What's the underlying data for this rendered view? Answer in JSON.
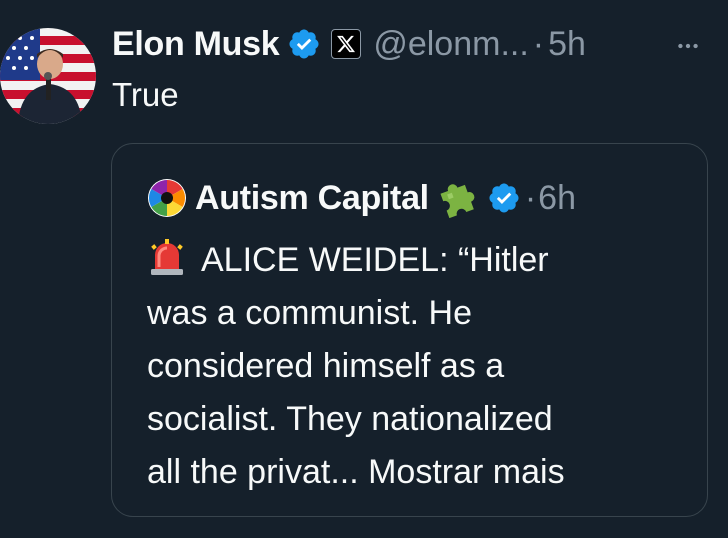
{
  "tweet": {
    "author_name": "Elon Musk",
    "handle": "@elonm...",
    "separator": "·",
    "time": "5h",
    "text": "True"
  },
  "quote": {
    "author_name": "Autism Capital",
    "separator": "·",
    "time": "6h",
    "lines": [
      "ALICE WEIDEL: “Hitler",
      "was a communist. He",
      "considered himself as a",
      "socialist. They nationalized",
      "all the privat... Mostrar mais"
    ]
  },
  "icons": {
    "verified": "verified-badge-icon",
    "x_logo": "x-logo-icon",
    "more": "more-options-icon",
    "puzzle": "puzzle-piece-icon",
    "siren": "siren-icon"
  },
  "colors": {
    "background": "#15202b",
    "text": "#f7f9f9",
    "secondary": "#8b98a5",
    "verified": "#1d9bf0",
    "border": "#38444d"
  }
}
